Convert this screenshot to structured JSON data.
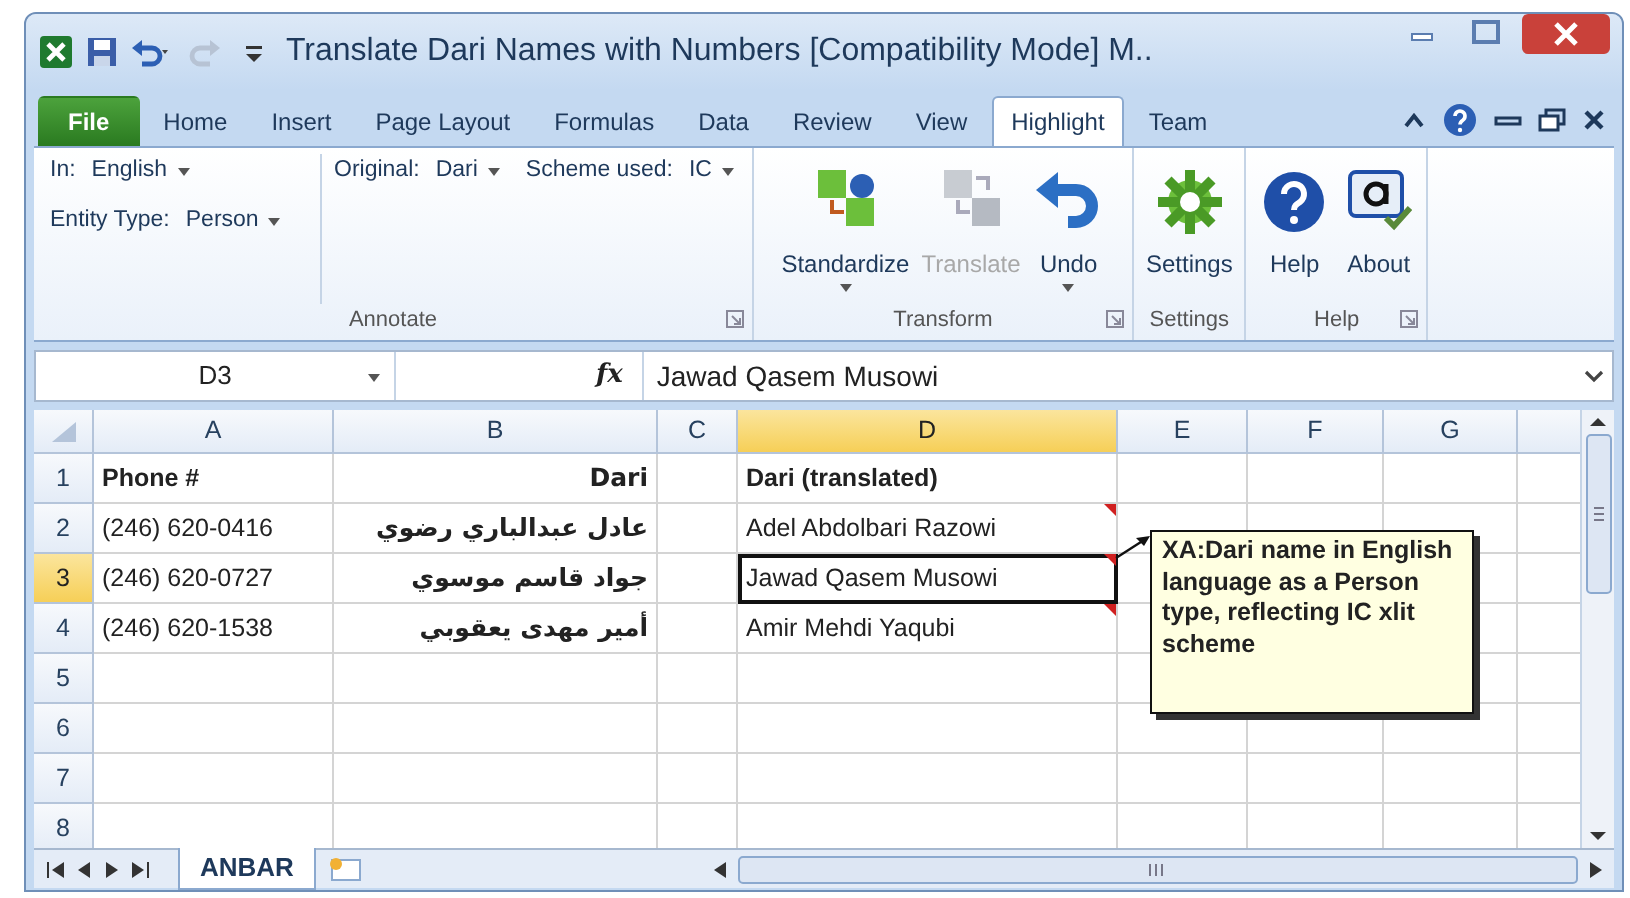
{
  "title_bar": {
    "title": "Translate Dari Names with Numbers  [Compatibility Mode] M.."
  },
  "ribbon_tabs": [
    {
      "label": "File",
      "kind": "file",
      "selected": false
    },
    {
      "label": "Home",
      "kind": "tab",
      "selected": false
    },
    {
      "label": "Insert",
      "kind": "tab",
      "selected": false
    },
    {
      "label": "Page Layout",
      "kind": "tab",
      "selected": false
    },
    {
      "label": "Formulas",
      "kind": "tab",
      "selected": false
    },
    {
      "label": "Data",
      "kind": "tab",
      "selected": false
    },
    {
      "label": "Review",
      "kind": "tab",
      "selected": false
    },
    {
      "label": "View",
      "kind": "tab",
      "selected": false
    },
    {
      "label": "Highlight",
      "kind": "tab",
      "selected": true
    },
    {
      "label": "Team",
      "kind": "tab",
      "selected": false
    }
  ],
  "annotate": {
    "group_label": "Annotate",
    "fields": [
      {
        "label": "In:",
        "value": "English"
      },
      {
        "label": "Entity Type:",
        "value": "Person"
      },
      {
        "label": "Original:",
        "value": "Dari"
      },
      {
        "label": "Scheme used:",
        "value": "IC"
      }
    ]
  },
  "groups": [
    {
      "group_label": "Transform",
      "launcher": true,
      "buttons": [
        {
          "label": "Standardize",
          "disabled": false,
          "dropdown": true
        },
        {
          "label": "Translate",
          "disabled": true,
          "dropdown": false
        },
        {
          "label": "Undo",
          "disabled": false,
          "dropdown": true
        }
      ]
    },
    {
      "group_label": "Settings",
      "launcher": false,
      "buttons": [
        {
          "label": "Settings",
          "disabled": false,
          "dropdown": false
        }
      ]
    },
    {
      "group_label": "Help",
      "launcher": true,
      "buttons": [
        {
          "label": "Help",
          "disabled": false,
          "dropdown": false
        },
        {
          "label": "About",
          "disabled": false,
          "dropdown": false
        }
      ]
    }
  ],
  "formula_bar": {
    "name_box": "D3",
    "fx": "fx",
    "value": "Jawad Qasem Musowi"
  },
  "columns": [
    {
      "label": "A",
      "selected": false
    },
    {
      "label": "B",
      "selected": false
    },
    {
      "label": "C",
      "selected": false
    },
    {
      "label": "D",
      "selected": true
    },
    {
      "label": "E",
      "selected": false
    },
    {
      "label": "F",
      "selected": false
    },
    {
      "label": "G",
      "selected": false
    }
  ],
  "rows": [
    {
      "number": "1",
      "selected": false,
      "comment": false,
      "cells": [
        "Phone #",
        "Dari",
        "",
        "Dari (translated)"
      ]
    },
    {
      "number": "2",
      "selected": false,
      "comment": true,
      "cells": [
        "(246) 620-0416",
        "عادل عبدالباري رضوي",
        "",
        "Adel Abdolbari Razowi"
      ]
    },
    {
      "number": "3",
      "selected": true,
      "comment": true,
      "cells": [
        "(246) 620-0727",
        "جواد قاسم موسوي",
        "",
        "Jawad Qasem Musowi"
      ]
    },
    {
      "number": "4",
      "selected": false,
      "comment": true,
      "cells": [
        "(246) 620-1538",
        "أمير مهدى يعقوبي",
        "",
        "Amir Mehdi Yaqubi"
      ]
    },
    {
      "number": "5",
      "selected": false,
      "comment": false,
      "cells": [
        "",
        "",
        "",
        ""
      ]
    },
    {
      "number": "6",
      "selected": false,
      "comment": false,
      "cells": [
        "",
        "",
        "",
        ""
      ]
    },
    {
      "number": "7",
      "selected": false,
      "comment": false,
      "cells": [
        "",
        "",
        "",
        ""
      ]
    },
    {
      "number": "8",
      "selected": false,
      "comment": false,
      "cells": [
        "",
        "",
        "",
        ""
      ]
    }
  ],
  "comment_box": {
    "text": "XA:Dari name in English language as a Person type, reflecting IC xlit scheme"
  },
  "sheet_tabs": [
    {
      "label": "ANBAR",
      "selected": true
    }
  ]
}
